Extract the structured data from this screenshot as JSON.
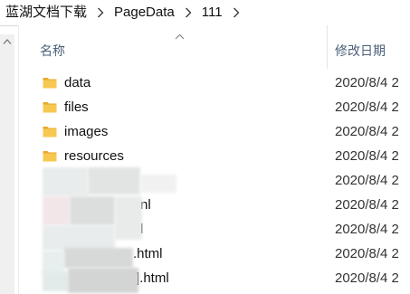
{
  "breadcrumb": [
    "蓝湖文档下载",
    "PageData",
    "111"
  ],
  "columns": {
    "name": "名称",
    "date": "修改日期"
  },
  "files": [
    {
      "name": "data",
      "date": "2020/8/4 2",
      "type": "folder",
      "icon": "folder-icon"
    },
    {
      "name": "files",
      "date": "2020/8/4 2",
      "type": "folder",
      "icon": "folder-icon"
    },
    {
      "name": "images",
      "date": "2020/8/4 2",
      "type": "folder",
      "icon": "folder-icon"
    },
    {
      "name": "resources",
      "date": "2020/8/4 2",
      "type": "folder",
      "icon": "folder-icon"
    },
    {
      "name": "",
      "date": "2020/8/4 2",
      "type": "html",
      "icon": "html-file-icon"
    },
    {
      "name": "nl",
      "date": "2020/8/4 2",
      "type": "html",
      "icon": "html-file-icon"
    },
    {
      "name": "l",
      "date": "2020/8/4 2",
      "type": "html",
      "icon": "html-file-icon"
    },
    {
      "name": ".html",
      "date": "2020/8/4 2",
      "type": "html",
      "icon": "html-file-icon"
    },
    {
      "name": "].html",
      "date": "2020/8/4 2",
      "type": "html",
      "icon": "html-file-icon"
    }
  ],
  "colors": {
    "folder": "#f5c244",
    "header_text": "#4c607a"
  }
}
